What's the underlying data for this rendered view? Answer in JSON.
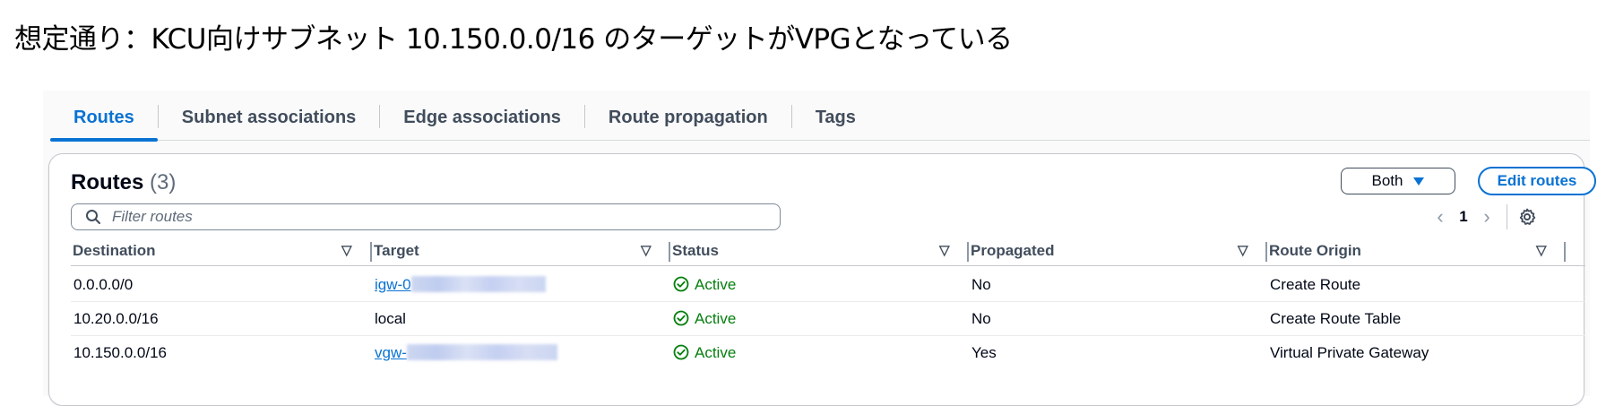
{
  "caption": "想定通り：KCU向けサブネット 10.150.0.0/16 のターゲットがVPGとなっている",
  "tabs": [
    {
      "label": "Routes",
      "active": true
    },
    {
      "label": "Subnet associations",
      "active": false
    },
    {
      "label": "Edge associations",
      "active": false
    },
    {
      "label": "Route propagation",
      "active": false
    },
    {
      "label": "Tags",
      "active": false
    }
  ],
  "routes": {
    "title": "Routes",
    "count": "(3)",
    "filter_placeholder": "Filter routes",
    "both_label": "Both",
    "edit_label": "Edit routes",
    "page": "1",
    "columns": [
      "Destination",
      "Target",
      "Status",
      "Propagated",
      "Route Origin"
    ],
    "rows": [
      {
        "destination": "0.0.0.0/0",
        "target": "igw-0",
        "target_link": true,
        "status": "Active",
        "propagated": "No",
        "origin": "Create Route"
      },
      {
        "destination": "10.20.0.0/16",
        "target": "local",
        "target_link": false,
        "status": "Active",
        "propagated": "No",
        "origin": "Create Route Table"
      },
      {
        "destination": "10.150.0.0/16",
        "target": "vgw-",
        "target_link": true,
        "status": "Active",
        "propagated": "Yes",
        "origin": "Virtual Private Gateway"
      }
    ]
  },
  "colors": {
    "accent": "#0972d3",
    "success": "#037f0c"
  },
  "icons": {
    "filter": "search-icon",
    "settings": "gear-icon",
    "status": "check-circle-icon",
    "prev": "chevron-left-icon",
    "next": "chevron-right-icon",
    "sort": "caret-down-icon"
  }
}
